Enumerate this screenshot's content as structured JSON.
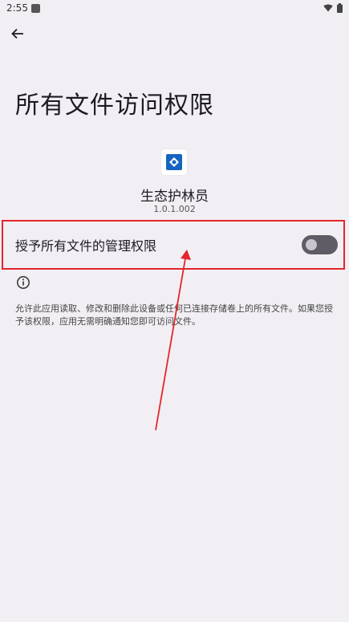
{
  "status_bar": {
    "time": "2:55"
  },
  "page": {
    "title": "所有文件访问权限",
    "app_name": "生态护林员",
    "app_version": "1.0.1.002",
    "toggle_label": "授予所有文件的管理权限",
    "toggle_state": "off",
    "description": "允许此应用读取、修改和删除此设备或任何已连接存储卷上的所有文件。如果您授予该权限，应用无需明确通知您即可访问文件。"
  },
  "colors": {
    "background": "#f2eff4",
    "highlight": "#e2262b",
    "switch_track": "#5f5c66",
    "app_icon_accent": "#1565c0"
  },
  "icons": [
    "notification-icon",
    "wifi-icon",
    "battery-icon",
    "back-arrow-icon",
    "app-icon",
    "info-icon"
  ]
}
